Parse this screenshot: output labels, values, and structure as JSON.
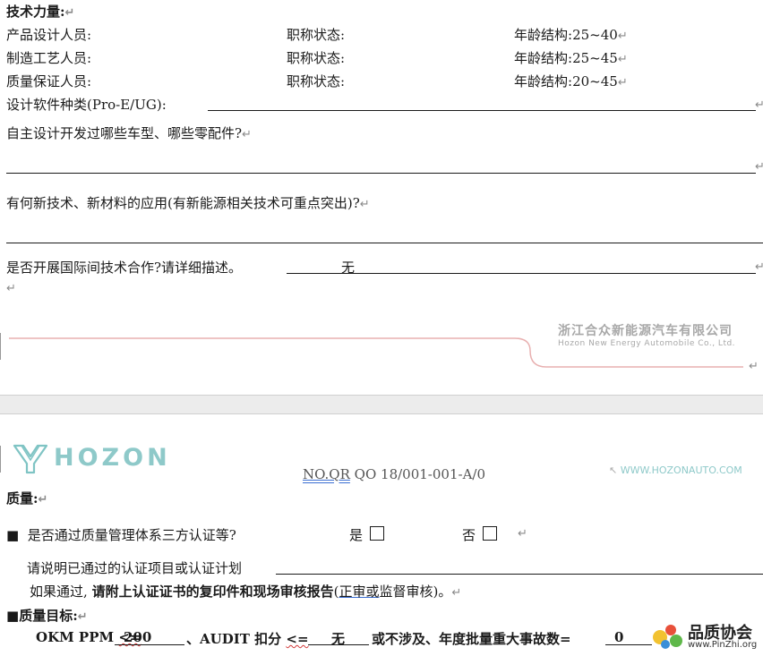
{
  "page1": {
    "tech_heading": "技术力量:",
    "staff_rows": [
      {
        "role": "产品设计人员:",
        "title_label": "职称状态:",
        "age_label": "年龄结构:",
        "age_value": "25~40"
      },
      {
        "role": "制造工艺人员:",
        "title_label": "职称状态:",
        "age_label": "年龄结构:",
        "age_value": "25~45"
      },
      {
        "role": "质量保证人员:",
        "title_label": "职称状态:",
        "age_label": "年龄结构:",
        "age_value": "20~45"
      }
    ],
    "software_label": "设计软件种类(Pro-E/UG):",
    "q_models": "自主设计开发过哪些车型、哪些零配件?",
    "q_newtech": "有何新技术、新材料的应用(有新能源相关技术可重点突出)?",
    "q_intl": "是否开展国际间技术合作?请详细描述。",
    "q_intl_answer": "无",
    "footer_company_cn": "浙江合众新能源汽车有限公司",
    "footer_company_en": "Hozon New Energy Automobile Co., Ltd."
  },
  "page2": {
    "logo_text": "HOZON",
    "doc_no_prefix": "NO.QR",
    "doc_no_rest": " QO 18/001-001-A/0",
    "website": "WWW.HOZONAUTO.COM",
    "quality_heading": "质量:",
    "bullet_glyph": "■",
    "cert_question": "是否通过质量管理体系三方认证等?",
    "yes_label": "是",
    "no_label": "否",
    "cert_plan_label": "请说明已通过的认证项目或认证计划",
    "if_passed": "如果通过,",
    "attach_note": "请附上认证证书的复印件和现场审核报告",
    "audit_open": "(",
    "audit_type_a": "正审或",
    "audit_type_b": "监督审核",
    "audit_close": ")。",
    "goal_heading": "质量目标:",
    "ppm_label": "OKM PPM",
    "ppm_le": "<=",
    "ppm_value": "200",
    "audit_label": "、AUDIT 扣分",
    "audit_le": "<=",
    "audit_value": "无",
    "goal_tail": "或不涉及、年度批量重大事故数=",
    "accident_value": "0",
    "watermark_cn": "品质协会",
    "watermark_url": "www.PinZhi.org"
  },
  "pilcrow": "↵"
}
